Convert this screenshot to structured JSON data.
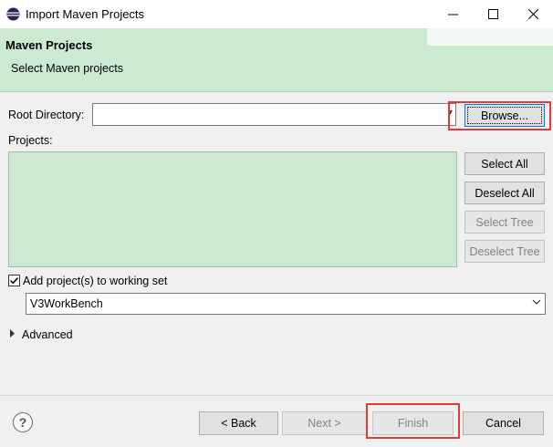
{
  "window": {
    "title": "Import Maven Projects",
    "icons": {
      "app": "eclipse-icon",
      "minimize": "minimize-icon",
      "maximize": "maximize-icon",
      "close": "close-icon"
    }
  },
  "header": {
    "title": "Maven Projects",
    "subtitle": "Select Maven projects"
  },
  "root_directory": {
    "label": "Root Directory:",
    "value": "",
    "browse_label": "Browse..."
  },
  "projects": {
    "label": "Projects:",
    "buttons": {
      "select_all": "Select All",
      "deselect_all": "Deselect All",
      "select_tree": "Select Tree",
      "deselect_tree": "Deselect Tree"
    }
  },
  "working_set": {
    "checkbox_label": "Add project(s) to working set",
    "checked": true,
    "selected": "V3WorkBench"
  },
  "advanced": {
    "label": "Advanced"
  },
  "footer": {
    "help_symbol": "?",
    "back_label": "< Back",
    "next_label": "Next >",
    "finish_label": "Finish",
    "cancel_label": "Cancel"
  },
  "colors": {
    "banner": "#cce9d2",
    "highlight": "#e53935",
    "focus": "#0078d7"
  }
}
